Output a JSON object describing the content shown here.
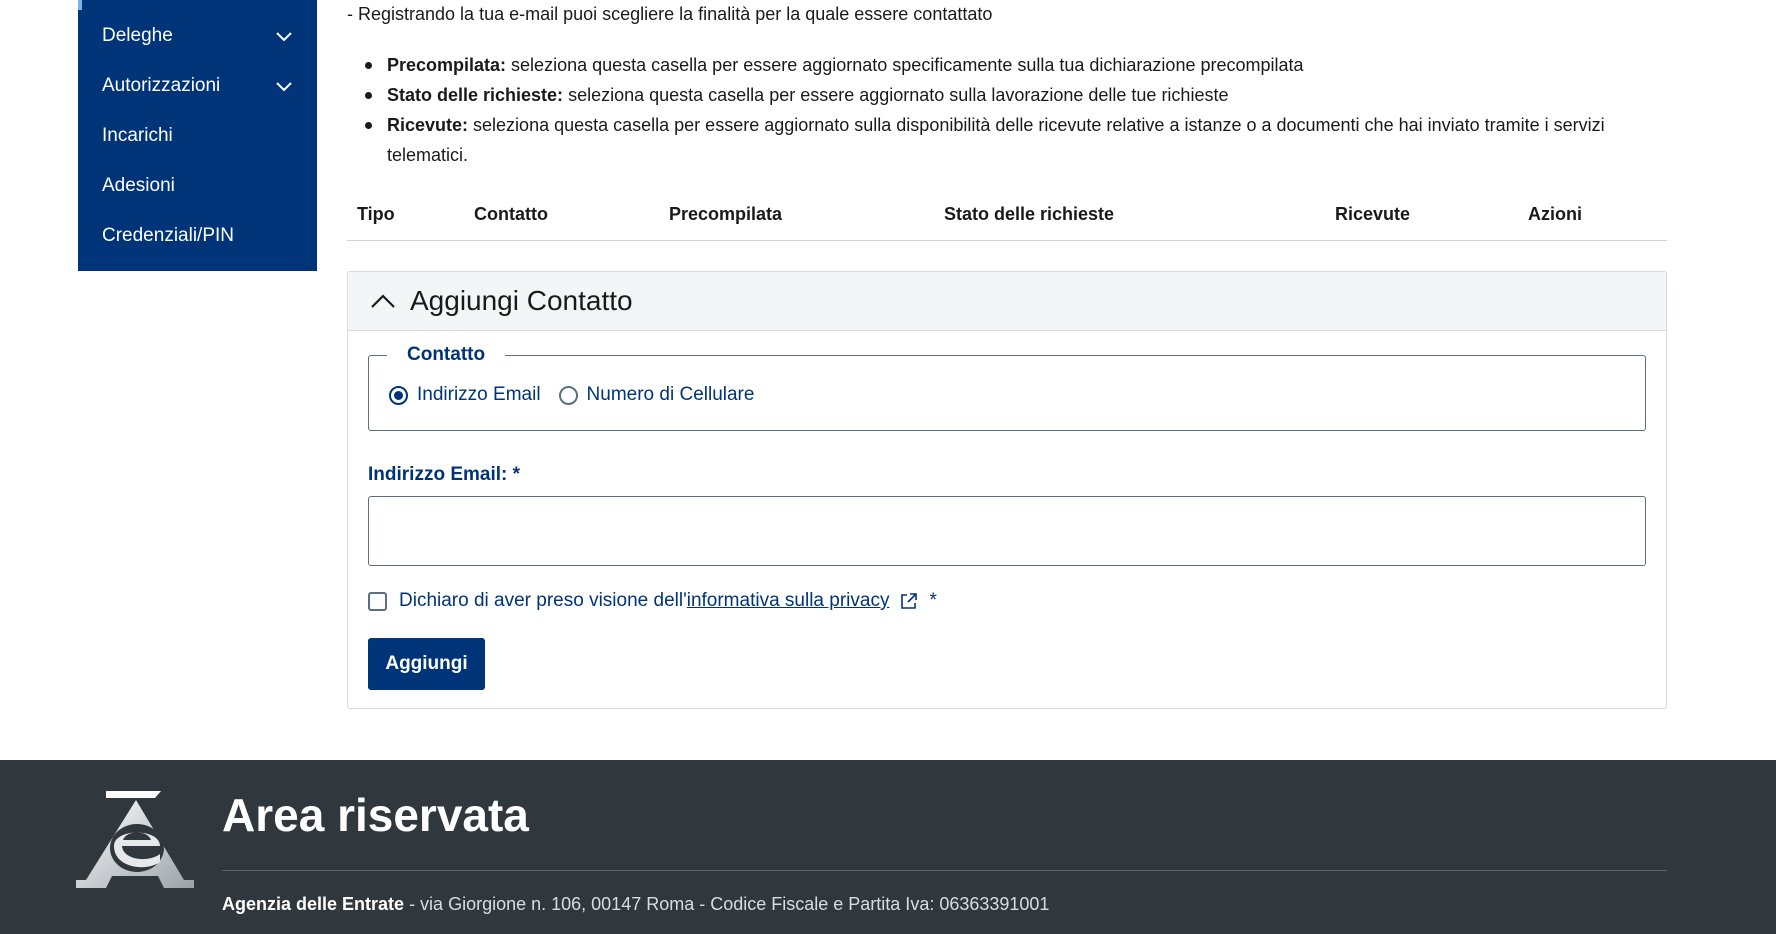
{
  "sidebar": {
    "items": [
      {
        "label": "Deleghe",
        "expandable": true
      },
      {
        "label": "Autorizzazioni",
        "expandable": true
      },
      {
        "label": "Incarichi",
        "expandable": false
      },
      {
        "label": "Adesioni",
        "expandable": false
      },
      {
        "label": "Credenziali/PIN",
        "expandable": false
      }
    ]
  },
  "main": {
    "intro": "- Registrando la tua e-mail puoi scegliere la finalità per la quale essere contattato",
    "bullets": [
      {
        "term": "Precompilata:",
        "text": " seleziona questa casella per essere aggiornato specificamente sulla tua dichiarazione precompilata"
      },
      {
        "term": "Stato delle richieste:",
        "text": " seleziona questa casella per essere aggiornato sulla lavorazione delle tue richieste"
      },
      {
        "term": "Ricevute:",
        "text": " seleziona questa casella per essere aggiornato sulla disponibilità delle ricevute relative a istanze o a documenti che hai inviato tramite i servizi telematici."
      }
    ],
    "table_headers": [
      "Tipo",
      "Contatto",
      "Precompilata",
      "Stato delle richieste",
      "Ricevute",
      "Azioni"
    ]
  },
  "form": {
    "accordion_title": "Aggiungi Contatto",
    "fieldset_legend": "Contatto",
    "radio_options": [
      "Indirizzo Email",
      "Numero di Cellulare"
    ],
    "selected_option": "Indirizzo Email",
    "email_label": "Indirizzo Email: *",
    "email_value": "",
    "privacy_prefix": "Dichiaro di aver preso visione dell'",
    "privacy_link": "informativa sulla privacy",
    "required_mark": "*",
    "privacy_checked": false,
    "submit_label": "Aggiungi"
  },
  "footer": {
    "title": "Area riservata",
    "org": "Agenzia delle Entrate",
    "address": " - via Giorgione n. 106, 00147 Roma - Codice Fiscale e Partita Iva: 06363391001"
  },
  "colors": {
    "primary": "#003479",
    "footer_bg": "#30373d"
  }
}
